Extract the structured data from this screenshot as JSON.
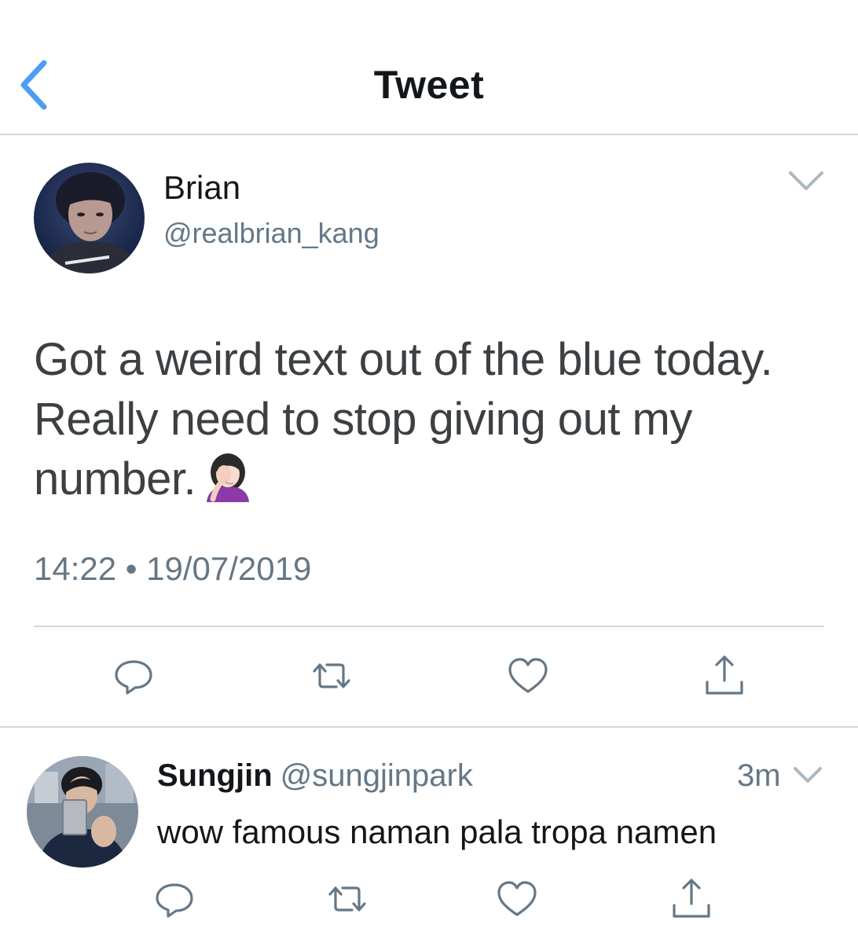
{
  "header": {
    "title": "Tweet",
    "back_icon": "chevron-left-icon",
    "accent_color": "#4a9ff5"
  },
  "tweet": {
    "author_name": "Brian",
    "author_handle": "@realbrian_kang",
    "text": "Got a weird text out of the blue today. Really need to stop giving out my number.",
    "emoji": "woman-facepalming-emoji",
    "timestamp": "14:22 • 19/07/2019",
    "actions": [
      "reply-icon",
      "retweet-icon",
      "like-icon",
      "share-icon"
    ]
  },
  "reply": {
    "author_name": "Sungjin",
    "author_handle": "@sungjinpark",
    "time": "3m",
    "text": "wow famous naman pala tropa namen",
    "actions": [
      "reply-icon",
      "retweet-icon",
      "like-icon",
      "share-icon"
    ]
  },
  "colors": {
    "text_primary": "#14171a",
    "text_secondary": "#657786",
    "divider": "#d3d6da",
    "icon_gray": "#657786"
  }
}
